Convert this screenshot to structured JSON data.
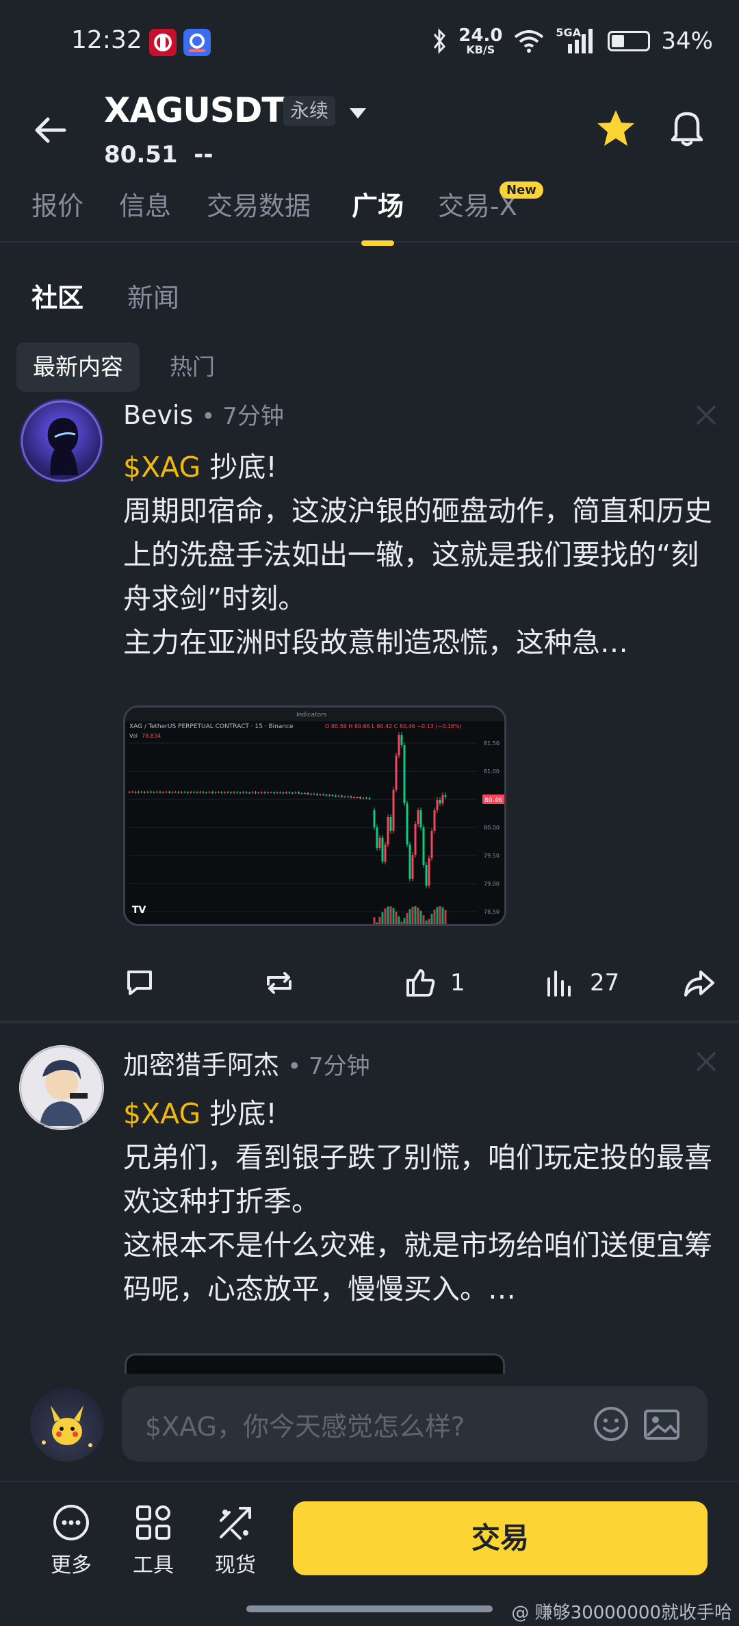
{
  "status_bar": {
    "time": "12:32",
    "net_speed": "24.0",
    "net_unit": "KB/S",
    "network": "5GA",
    "battery": "34%"
  },
  "header": {
    "symbol": "XAGUSDT",
    "contract_type": "永续",
    "price": "80.51",
    "change": "--"
  },
  "main_tabs": [
    {
      "label": "报价"
    },
    {
      "label": "信息"
    },
    {
      "label": "交易数据"
    },
    {
      "label": "广场"
    },
    {
      "label": "交易-X"
    }
  ],
  "new_badge": "New",
  "sub_tabs": [
    {
      "label": "社区"
    },
    {
      "label": "新闻"
    }
  ],
  "filter_chips": [
    {
      "label": "最新内容"
    },
    {
      "label": "热门"
    }
  ],
  "posts": [
    {
      "author": "Bevis",
      "time": "7分钟",
      "cashtag": "$XAG",
      "headline": "抄底!",
      "body": "周期即宿命，这波沪银的砸盘动作，简直和历史上的洗盘手法如出一辙，这就是我们要找的“刻舟求剑”时刻。\n主力在亚洲时段故意制造恐慌，这种急…",
      "stats": {
        "likes": "1",
        "views": "27"
      }
    },
    {
      "author": "加密猎手阿杰",
      "time": "7分钟",
      "cashtag": "$XAG",
      "headline": "抄底!",
      "body": "兄弟们，看到银子跌了别慌，咱们玩定投的最喜欢这种打折季。\n这根本不是什么灾难，就是市场给咱们送便宜筹码呢，心态放平，慢慢买入。…"
    }
  ],
  "chart_card": {
    "title": "XAG / TetherUS PERPETUAL CONTRACT · 15 · Binance",
    "ohlc": "O 80.59  H 80.66  L 80.42  C 80.46  −0.13 (−0.16%)",
    "vol": "Vol",
    "vol_value": "78.834",
    "last_price": "80.46",
    "toolbar": "Indicators",
    "y_ticks": [
      "81.50",
      "81.00",
      "80.50",
      "80.00",
      "79.50",
      "79.00",
      "78.50"
    ]
  },
  "composer": {
    "placeholder": "$XAG，你今天感觉怎么样?"
  },
  "bottom_nav": {
    "more": "更多",
    "tools": "工具",
    "spot": "现货",
    "trade": "交易"
  },
  "watermark": "@ 赚够30000000就收手哈",
  "colors": {
    "accent": "#fcd535",
    "up": "#0ecb81",
    "down": "#f6465d",
    "cashtag": "#f0b90b"
  }
}
